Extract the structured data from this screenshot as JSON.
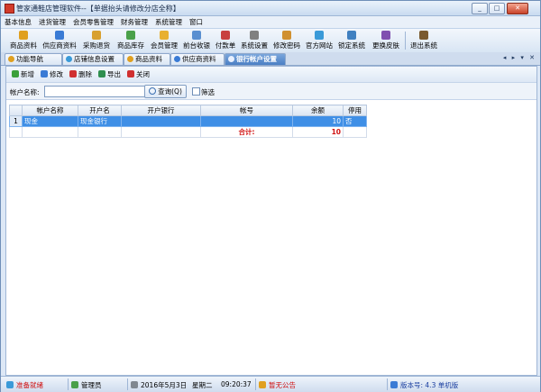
{
  "window": {
    "title": "管家通鞋店管理软件--【单据抬头请修改分店全称】",
    "buttons": [
      "_",
      "□",
      "✕"
    ]
  },
  "menu": [
    "基本信息",
    "进货管理",
    "会员零售管理",
    "财务管理",
    "系统管理",
    "窗口"
  ],
  "toolbar": [
    {
      "label": "商品资料",
      "icon": "product-icon",
      "color": "#e0a020"
    },
    {
      "label": "供应商资料",
      "icon": "supplier-icon",
      "color": "#3a7bd5"
    },
    {
      "label": "采购退货",
      "icon": "return-icon",
      "color": "#d8a030"
    },
    {
      "label": "商品库存",
      "icon": "stock-icon",
      "color": "#4aa04a"
    },
    {
      "label": "会员管理",
      "icon": "member-icon",
      "color": "#e8b030"
    },
    {
      "label": "前台收银",
      "icon": "cashier-icon",
      "color": "#5a8fd0"
    },
    {
      "label": "付款单",
      "icon": "payment-icon",
      "color": "#c84040"
    },
    {
      "label": "系统设置",
      "icon": "settings-icon",
      "color": "#808080"
    },
    {
      "label": "修改密码",
      "icon": "password-icon",
      "color": "#d09030"
    },
    {
      "label": "官方网站",
      "icon": "website-icon",
      "color": "#3a9ad8"
    },
    {
      "label": "锁定系统",
      "icon": "lock-icon",
      "color": "#4080c0"
    },
    {
      "label": "更换皮肤",
      "icon": "skin-icon",
      "color": "#8050b0"
    },
    {
      "label": "退出系统",
      "icon": "exit-icon",
      "color": "#7a5a30"
    }
  ],
  "tabs": [
    {
      "label": "功能导航",
      "color": "#e0a020"
    },
    {
      "label": "店铺信息设置",
      "color": "#3a9ad8"
    },
    {
      "label": "商品资料",
      "color": "#e0a020"
    },
    {
      "label": "供应商资料",
      "color": "#3a7bd5"
    },
    {
      "label": "银行帐户设置",
      "color": "#e8f0ff",
      "active": true
    }
  ],
  "tab_nav": "◂ ▸ ▾ ✕",
  "actions": [
    {
      "label": "新增",
      "icon": "add-icon",
      "color": "#3aa03a"
    },
    {
      "label": "修改",
      "icon": "edit-icon",
      "color": "#3a7bd5"
    },
    {
      "label": "删除",
      "icon": "delete-icon",
      "color": "#d03030"
    },
    {
      "label": "导出",
      "icon": "export-icon",
      "color": "#2f8f4f"
    },
    {
      "label": "关闭",
      "icon": "close-icon",
      "color": "#d03030"
    }
  ],
  "filter": {
    "label": "帐户名称:",
    "value": "",
    "search_label": "查询(Q)",
    "checkbox_label": "筛选"
  },
  "grid": {
    "columns": [
      "帐户名称",
      "开户名",
      "开户银行",
      "帐号",
      "余额",
      "停用"
    ],
    "rows": [
      {
        "no": "1",
        "cells": [
          "现金",
          "现金银行",
          "",
          "",
          "10",
          "否"
        ]
      }
    ],
    "total_label": "合计:",
    "total_value": "10"
  },
  "status": {
    "state": "准备就绪",
    "user": "管理员",
    "date": "2016年5月3日",
    "weekday": "星期二",
    "time": "09:20:37",
    "notice": "暂无公告",
    "version": "版本号: 4.3 单机版"
  }
}
